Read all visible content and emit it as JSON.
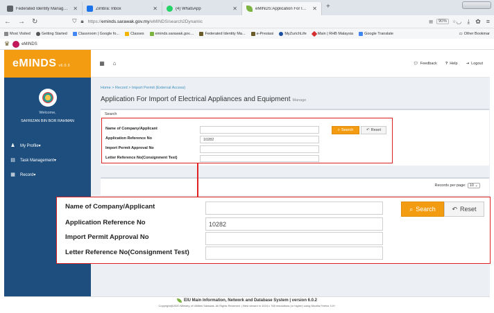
{
  "browser": {
    "tabs": [
      {
        "label": "Federated Identity Managemen",
        "color": "#5f6368",
        "active": false
      },
      {
        "label": "Zimbra: Inbox",
        "color": "#1a73e8",
        "active": false
      },
      {
        "label": "(4) WhatsApp",
        "color": "#25d366",
        "active": false
      },
      {
        "label": "eMINDS:Application For Impor",
        "color": "#7cb342",
        "active": true
      }
    ],
    "url_prefix": "https://",
    "url_host": "eminds.sarawak.gov.my",
    "url_path": "/eMINDS/search2Dynamic",
    "zoom": "90%",
    "bookmarks": [
      {
        "label": "Most Visited",
        "color": "#888"
      },
      {
        "label": "Getting Started",
        "color": "#555"
      },
      {
        "label": "Classroom | Google fo...",
        "color": "#4285f4"
      },
      {
        "label": "Classes",
        "color": "#f4b400"
      },
      {
        "label": "eminds.sarawak.gov....",
        "color": "#7cb342"
      },
      {
        "label": "Federated Identity Ma...",
        "color": "#6b5b2a"
      },
      {
        "label": "e-Prestasi",
        "color": "#6b5b2a"
      },
      {
        "label": "MyZurichLife",
        "color": "#1a4fa0"
      },
      {
        "label": "Main | RHB Malaysia",
        "color": "#d32f2f"
      },
      {
        "label": "Google Translate",
        "color": "#4285f4"
      }
    ],
    "other_bookmarks": "Other Bookmar",
    "site_name": "eMINDS"
  },
  "app": {
    "brand": "eMINDS",
    "version": "v6.0.0",
    "welcome": "Welcome,",
    "user_name": "SAFRIZAN BIN BOR RAHMAN",
    "menu": [
      {
        "label": "My Profile",
        "icon": "user-icon"
      },
      {
        "label": "Task Management",
        "icon": "tasks-icon"
      },
      {
        "label": "Record",
        "icon": "table-icon"
      }
    ],
    "feedback": "Feedback",
    "help": "Help",
    "logout": "Logout"
  },
  "page": {
    "breadcrumb": "Home > Record > Import Permit (External Access)",
    "title": "Application For Import of Electrical Appliances and Equipment",
    "title_small": "Manage",
    "search_header": "Search",
    "fields": [
      {
        "label": "Name of Company/Applicant",
        "value": ""
      },
      {
        "label": "Application Reference No",
        "value": "10282"
      },
      {
        "label": "Import Permit Approval No",
        "value": ""
      },
      {
        "label": "Letter Reference No(Consignment Test)",
        "value": ""
      }
    ],
    "search_button": "Search",
    "reset_button": "Reset",
    "records_per_page_label": "Records per page:",
    "records_per_page_value": "10"
  },
  "footer": {
    "line1": "EIU Main Information, Network and Database System | version 6.0.2",
    "line2": "Copyright@2020 Ministry of Utilities Sarawak. All Rights Reserved. | Best viewed in 1024 x 768 resolutions (or higher) using Mozilla Firefox 3.0+"
  }
}
